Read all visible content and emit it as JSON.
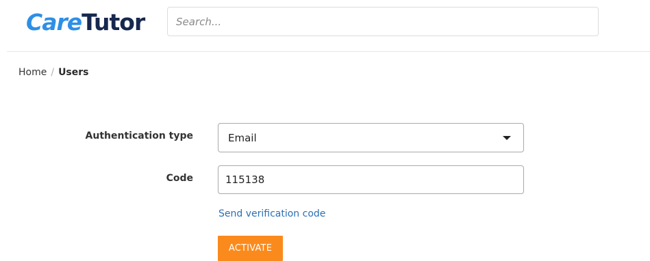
{
  "header": {
    "logo": {
      "part1": "Care",
      "part2": "Tutor"
    },
    "search": {
      "placeholder": "Search...",
      "value": ""
    }
  },
  "breadcrumb": {
    "home": "Home",
    "separator": "/",
    "current": "Users"
  },
  "form": {
    "auth_type": {
      "label": "Authentication type",
      "selected": "Email"
    },
    "code": {
      "label": "Code",
      "value": "115138"
    },
    "send_link": "Send verification code",
    "activate_label": "ACTIVATE"
  },
  "colors": {
    "logo_care": "#2e8fe6",
    "logo_tutor": "#17284f",
    "link": "#2a6fb5",
    "activate_bg": "#fb8a1c"
  }
}
